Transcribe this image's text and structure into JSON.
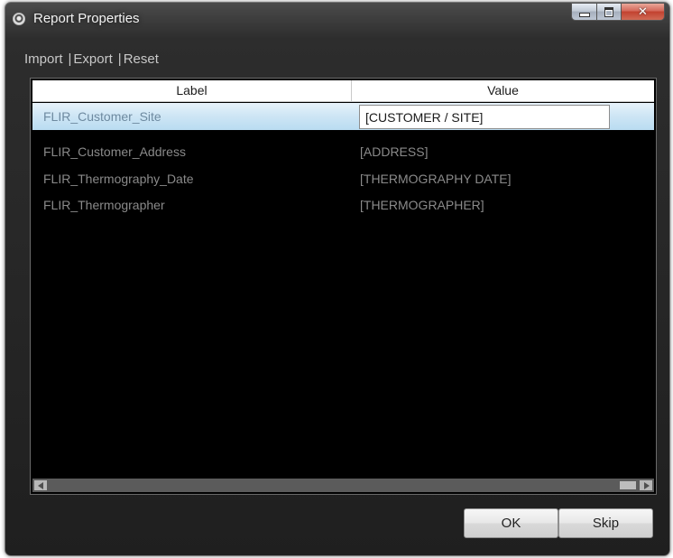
{
  "window": {
    "title": "Report Properties",
    "icon": "app-icon",
    "caption_buttons": [
      "minimize-icon",
      "maximize-icon",
      "close-icon"
    ]
  },
  "menu": {
    "items": [
      "Import",
      "Export",
      "Reset"
    ],
    "separator": "|"
  },
  "grid": {
    "columns": [
      "Label",
      "Value"
    ],
    "rows": [
      {
        "label": "FLIR_Customer_Site",
        "value": "[CUSTOMER / SITE]",
        "selected": true
      },
      {
        "label": "FLIR_Customer_Address",
        "value": "[ADDRESS]",
        "selected": false
      },
      {
        "label": "FLIR_Thermography_Date",
        "value": "[THERMOGRAPHY DATE]",
        "selected": false
      },
      {
        "label": "FLIR_Thermographer",
        "value": "[THERMOGRAPHER]",
        "selected": false
      }
    ]
  },
  "buttons": {
    "ok": "OK",
    "skip": "Skip"
  },
  "colors": {
    "background": "#000000",
    "selected_row": "#cfe6f5",
    "text_dim": "#8a8a8a"
  }
}
